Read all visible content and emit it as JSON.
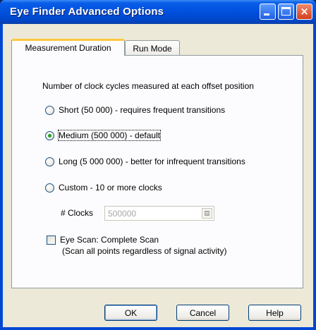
{
  "window": {
    "title": "Eye Finder Advanced Options"
  },
  "title_buttons": {
    "minimize": "minimize-icon",
    "maximize": "maximize-icon",
    "close": "×"
  },
  "tabs": [
    {
      "label": "Measurement Duration",
      "active": true
    },
    {
      "label": "Run Mode",
      "active": false
    }
  ],
  "measurement": {
    "heading": "Number of clock cycles measured at each offset position",
    "options": [
      {
        "label": "Short (50 000) - requires frequent transitions",
        "selected": false
      },
      {
        "label": "Medium (500 000) - default",
        "selected": true
      },
      {
        "label": "Long (5 000 000) - better for infrequent transitions",
        "selected": false
      },
      {
        "label": "Custom - 10 or more clocks",
        "selected": false
      }
    ],
    "clocks_label": "# Clocks",
    "clocks_value": "500000",
    "eye_scan_label": "Eye Scan: Complete Scan",
    "eye_scan_note": "(Scan all points regardless of signal activity)",
    "eye_scan_checked": false
  },
  "buttons": {
    "ok": "OK",
    "cancel": "Cancel",
    "help": "Help"
  },
  "colors": {
    "title_bar": "#0050de",
    "face": "#ece9d8",
    "selected_radio": "#21a121",
    "tab_highlight": "#ffc83c"
  }
}
